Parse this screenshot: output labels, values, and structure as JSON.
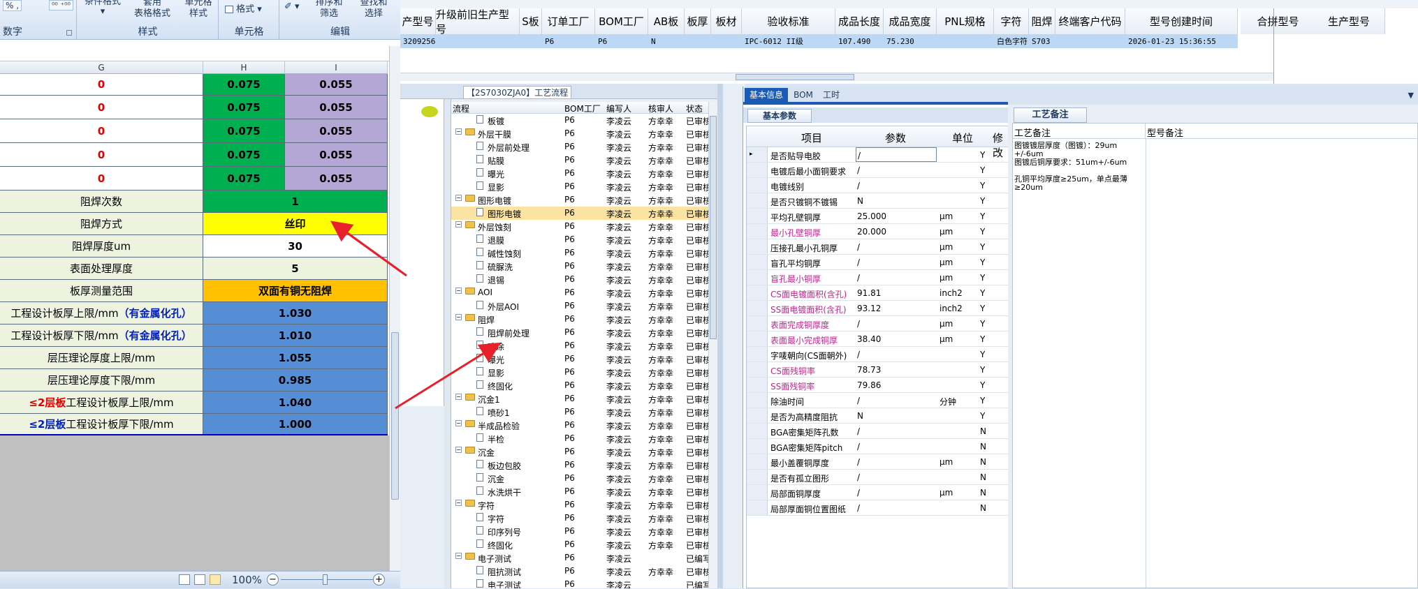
{
  "excel": {
    "ribbon": {
      "g1": {
        "row1": "% , ",
        "row1b": "⁰⁰ ⁺⁰⁰",
        "label": "数字"
      },
      "g2": {
        "btn1": "条件格式",
        "btn2": "套用\n表格格式",
        "btn3": "单元格\n样式",
        "label": "样式"
      },
      "g3": {
        "btn": "格式",
        "label": "单元格"
      },
      "g4": {
        "btn1": "排序和\n筛选",
        "btn2": "查找和\n选择",
        "label": "编辑"
      }
    },
    "cols": [
      "G",
      "H",
      "I"
    ],
    "top_rows": [
      {
        "g": "0",
        "h": "0.075",
        "i": "0.055"
      },
      {
        "g": "0",
        "h": "0.075",
        "i": "0.055"
      },
      {
        "g": "0",
        "h": "0.075",
        "i": "0.055"
      },
      {
        "g": "0",
        "h": "0.075",
        "i": "0.055"
      },
      {
        "g": "0",
        "h": "0.075",
        "i": "0.055"
      }
    ],
    "rows": [
      {
        "label": "阻焊次数",
        "value": "1"
      },
      {
        "label": "阻焊方式",
        "value": "丝印"
      },
      {
        "label": "阻焊厚度um",
        "value": "30"
      },
      {
        "label": "表面处理厚度",
        "value": "5"
      },
      {
        "label": "板厚测量范围",
        "value": "双面有铜无阻焊"
      },
      {
        "label": "工程设计板厚上限/mm",
        "label_em": "（有金属化孔）",
        "value": "1.030"
      },
      {
        "label": "工程设计板厚下限/mm",
        "label_em": "（有金属化孔）",
        "value": "1.010"
      },
      {
        "label": "层压理论厚度上限/mm",
        "value": "1.055"
      },
      {
        "label": "层压理论厚度下限/mm",
        "value": "0.985"
      },
      {
        "label_red": "≤2层板",
        "label": "工程设计板厚上限/mm",
        "value": "1.040"
      },
      {
        "label_blue": "≤2层板",
        "label": "工程设计板厚下限/mm",
        "value": "1.000"
      }
    ],
    "zoom": "100%",
    "colors": {
      "green": "#00b050",
      "purple": "#b4a7d6",
      "yellow": "#ffff00",
      "orange": "#ffc000",
      "blue": "#558ed5",
      "beige": "#eef3df"
    }
  },
  "topgrid": {
    "headers": [
      "产型号",
      "升级前旧生产型号",
      "S板",
      "订单工厂",
      "BOM工厂",
      "AB板",
      "板厚",
      "板材",
      "验收标准",
      "成品长度",
      "成品宽度",
      "PNL规格",
      "字符",
      "阻焊",
      "终端客户代码",
      "型号创建时间",
      "合拼型号",
      "生产型号"
    ],
    "row": [
      "3209256",
      "",
      "",
      "P6",
      "P6",
      "N",
      "",
      "",
      "IPC-6012 II级",
      "107.490",
      "75.230",
      "",
      "白色字符",
      "S703",
      "",
      "2026-01-23 15:36:55"
    ]
  },
  "process": {
    "title": "【2S7030ZJA0】工艺流程",
    "headers": [
      "流程",
      "BOM工厂",
      "编写人",
      "核审人",
      "状态"
    ],
    "rows": [
      {
        "lvl": 2,
        "name": "板镀",
        "f": "P6",
        "w": "李凌云",
        "r": "方幸幸",
        "s": "已审核"
      },
      {
        "lvl": 1,
        "name": "外层干膜",
        "f": "P6",
        "w": "李凌云",
        "r": "方幸幸",
        "s": "已审核"
      },
      {
        "lvl": 2,
        "name": "外层前处理",
        "f": "P6",
        "w": "李凌云",
        "r": "方幸幸",
        "s": "已审核"
      },
      {
        "lvl": 2,
        "name": "贴膜",
        "f": "P6",
        "w": "李凌云",
        "r": "方幸幸",
        "s": "已审核"
      },
      {
        "lvl": 2,
        "name": "曝光",
        "f": "P6",
        "w": "李凌云",
        "r": "方幸幸",
        "s": "已审核"
      },
      {
        "lvl": 2,
        "name": "显影",
        "f": "P6",
        "w": "李凌云",
        "r": "方幸幸",
        "s": "已审核"
      },
      {
        "lvl": 1,
        "name": "图形电镀",
        "f": "P6",
        "w": "李凌云",
        "r": "方幸幸",
        "s": "已审核"
      },
      {
        "lvl": 2,
        "name": "图形电镀",
        "f": "P6",
        "w": "李凌云",
        "r": "方幸幸",
        "s": "已审核",
        "sel": true
      },
      {
        "lvl": 1,
        "name": "外层蚀刻",
        "f": "P6",
        "w": "李凌云",
        "r": "方幸幸",
        "s": "已审核"
      },
      {
        "lvl": 2,
        "name": "退膜",
        "f": "P6",
        "w": "李凌云",
        "r": "方幸幸",
        "s": "已审核"
      },
      {
        "lvl": 2,
        "name": "碱性蚀刻",
        "f": "P6",
        "w": "李凌云",
        "r": "方幸幸",
        "s": "已审核"
      },
      {
        "lvl": 2,
        "name": "硫脲洗",
        "f": "P6",
        "w": "李凌云",
        "r": "方幸幸",
        "s": "已审核"
      },
      {
        "lvl": 2,
        "name": "退锡",
        "f": "P6",
        "w": "李凌云",
        "r": "方幸幸",
        "s": "已审核"
      },
      {
        "lvl": 1,
        "name": "AOI",
        "f": "P6",
        "w": "李凌云",
        "r": "方幸幸",
        "s": "已审核"
      },
      {
        "lvl": 2,
        "name": "外层AOI",
        "f": "P6",
        "w": "李凌云",
        "r": "方幸幸",
        "s": "已审核"
      },
      {
        "lvl": 1,
        "name": "阻焊",
        "f": "P6",
        "w": "李凌云",
        "r": "方幸幸",
        "s": "已审核"
      },
      {
        "lvl": 2,
        "name": "阻焊前处理",
        "f": "P6",
        "w": "李凌云",
        "r": "方幸幸",
        "s": "已审核"
      },
      {
        "lvl": 2,
        "name": "喷涂",
        "f": "P6",
        "w": "李凌云",
        "r": "方幸幸",
        "s": "已审核"
      },
      {
        "lvl": 2,
        "name": "曝光",
        "f": "P6",
        "w": "李凌云",
        "r": "方幸幸",
        "s": "已审核"
      },
      {
        "lvl": 2,
        "name": "显影",
        "f": "P6",
        "w": "李凌云",
        "r": "方幸幸",
        "s": "已审核"
      },
      {
        "lvl": 2,
        "name": "终固化",
        "f": "P6",
        "w": "李凌云",
        "r": "方幸幸",
        "s": "已审核"
      },
      {
        "lvl": 1,
        "name": "沉金1",
        "f": "P6",
        "w": "李凌云",
        "r": "方幸幸",
        "s": "已审核"
      },
      {
        "lvl": 2,
        "name": "喷砂1",
        "f": "P6",
        "w": "李凌云",
        "r": "方幸幸",
        "s": "已审核"
      },
      {
        "lvl": 1,
        "name": "半成品检验",
        "f": "P6",
        "w": "李凌云",
        "r": "方幸幸",
        "s": "已审核"
      },
      {
        "lvl": 2,
        "name": "半检",
        "f": "P6",
        "w": "李凌云",
        "r": "方幸幸",
        "s": "已审核"
      },
      {
        "lvl": 1,
        "name": "沉金",
        "f": "P6",
        "w": "李凌云",
        "r": "方幸幸",
        "s": "已审核"
      },
      {
        "lvl": 2,
        "name": "板边包胶",
        "f": "P6",
        "w": "李凌云",
        "r": "方幸幸",
        "s": "已审核"
      },
      {
        "lvl": 2,
        "name": "沉金",
        "f": "P6",
        "w": "李凌云",
        "r": "方幸幸",
        "s": "已审核"
      },
      {
        "lvl": 2,
        "name": "水洗烘干",
        "f": "P6",
        "w": "李凌云",
        "r": "方幸幸",
        "s": "已审核"
      },
      {
        "lvl": 1,
        "name": "字符",
        "f": "P6",
        "w": "李凌云",
        "r": "方幸幸",
        "s": "已审核"
      },
      {
        "lvl": 2,
        "name": "字符",
        "f": "P6",
        "w": "李凌云",
        "r": "方幸幸",
        "s": "已审核"
      },
      {
        "lvl": 2,
        "name": "印序列号",
        "f": "P6",
        "w": "李凌云",
        "r": "方幸幸",
        "s": "已审核"
      },
      {
        "lvl": 2,
        "name": "终固化",
        "f": "P6",
        "w": "李凌云",
        "r": "方幸幸",
        "s": "已审核"
      },
      {
        "lvl": 1,
        "name": "电子测试",
        "f": "P6",
        "w": "李凌云",
        "r": "",
        "s": "已编写"
      },
      {
        "lvl": 2,
        "name": "阻抗测试",
        "f": "P6",
        "w": "李凌云",
        "r": "方幸幸",
        "s": "已审核"
      },
      {
        "lvl": 2,
        "name": "电子测试",
        "f": "P6",
        "w": "李凌云",
        "r": "",
        "s": "已编写"
      }
    ]
  },
  "params": {
    "tabs": [
      "基本信息",
      "BOM",
      "工时"
    ],
    "subtab": "基本参数",
    "headers": [
      "项目",
      "参数",
      "单位",
      "修改"
    ],
    "rows": [
      {
        "item": "是否贴导电胶",
        "val": "/",
        "unit": "",
        "mod": "Y",
        "pink": false,
        "sel": true
      },
      {
        "item": "电镀后最小面铜要求",
        "val": "/",
        "unit": "",
        "mod": "Y"
      },
      {
        "item": "电镀线别",
        "val": "/",
        "unit": "",
        "mod": "Y"
      },
      {
        "item": "是否只镀铜不镀锡",
        "val": "N",
        "unit": "",
        "mod": "Y"
      },
      {
        "item": "平均孔壁铜厚",
        "val": "25.000",
        "unit": "μm",
        "mod": "Y"
      },
      {
        "item": "最小孔壁铜厚",
        "val": "20.000",
        "unit": "μm",
        "mod": "Y",
        "pink": true
      },
      {
        "item": "压接孔最小孔铜厚",
        "val": "/",
        "unit": "μm",
        "mod": "Y"
      },
      {
        "item": "盲孔平均铜厚",
        "val": "/",
        "unit": "μm",
        "mod": "Y"
      },
      {
        "item": "盲孔最小铜厚",
        "val": "/",
        "unit": "μm",
        "mod": "Y",
        "pink": true
      },
      {
        "item": "CS面电镀面积(含孔)",
        "val": "91.81",
        "unit": "inch2",
        "mod": "Y",
        "pink": true
      },
      {
        "item": "SS面电镀面积(含孔)",
        "val": "93.12",
        "unit": "inch2",
        "mod": "Y",
        "pink": true
      },
      {
        "item": "表面完成铜厚度",
        "val": "/",
        "unit": "μm",
        "mod": "Y",
        "pink": true
      },
      {
        "item": "表面最小完成铜厚",
        "val": "38.40",
        "unit": "μm",
        "mod": "Y",
        "pink": true
      },
      {
        "item": "字唛朝向(CS面朝外)",
        "val": "/",
        "unit": "",
        "mod": "Y"
      },
      {
        "item": "CS面残铜率",
        "val": "78.73",
        "unit": "",
        "mod": "Y",
        "pink": true
      },
      {
        "item": "SS面残铜率",
        "val": "79.86",
        "unit": "",
        "mod": "Y",
        "pink": true
      },
      {
        "item": "除油时间",
        "val": "/",
        "unit": "分钟",
        "mod": "Y"
      },
      {
        "item": "是否为高精度阻抗",
        "val": "N",
        "unit": "",
        "mod": "Y"
      },
      {
        "item": "BGA密集矩阵孔数",
        "val": "/",
        "unit": "",
        "mod": "N"
      },
      {
        "item": "BGA密集矩阵pitch",
        "val": "/",
        "unit": "",
        "mod": "N"
      },
      {
        "item": "最小盖覆铜厚度",
        "val": "/",
        "unit": "μm",
        "mod": "N"
      },
      {
        "item": "是否有孤立图形",
        "val": "/",
        "unit": "",
        "mod": "N"
      },
      {
        "item": "局部面铜厚度",
        "val": "/",
        "unit": "μm",
        "mod": "N"
      },
      {
        "item": "局部厚面铜位置图纸",
        "val": "/",
        "unit": "",
        "mod": "N"
      }
    ]
  },
  "notes": {
    "tab": "工艺备注",
    "col1": "工艺备注",
    "col2": "型号备注",
    "lines": [
      "图镀镀层厚度（图镀）：29um",
      "+/-6um",
      "图镀后铜厚要求：51um+/-6um",
      "",
      "孔铜平均厚度≥25um，单点最薄",
      "≥20um"
    ]
  }
}
